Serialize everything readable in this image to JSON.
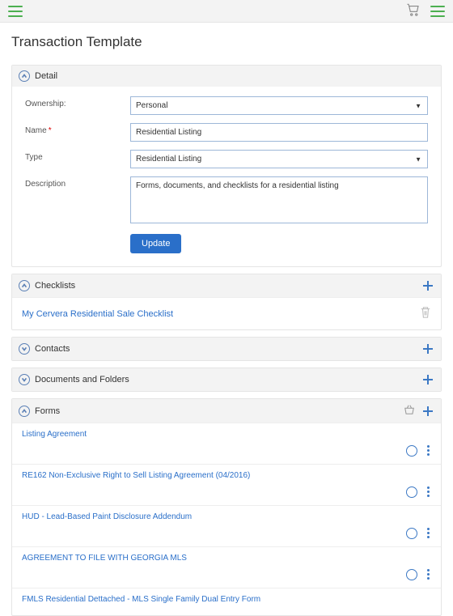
{
  "page": {
    "title": "Transaction Template"
  },
  "detail": {
    "header": "Detail",
    "labels": {
      "ownership": "Ownership:",
      "name": "Name",
      "type": "Type",
      "description": "Description"
    },
    "ownership": "Personal",
    "name": "Residential Listing",
    "type": "Residential Listing",
    "description": "Forms, documents, and checklists for a residential listing",
    "update_btn": "Update"
  },
  "checklists": {
    "header": "Checklists",
    "items": [
      {
        "label": "My Cervera Residential Sale Checklist"
      }
    ]
  },
  "contacts": {
    "header": "Contacts"
  },
  "documents": {
    "header": "Documents and Folders"
  },
  "forms": {
    "header": "Forms",
    "items": [
      {
        "label": "Listing Agreement"
      },
      {
        "label": "RE162 Non-Exclusive Right to Sell Listing Agreement (04/2016)"
      },
      {
        "label": "HUD - Lead-Based Paint Disclosure Addendum"
      },
      {
        "label": "AGREEMENT TO FILE WITH GEORGIA MLS"
      },
      {
        "label": "FMLS Residential Dettached - MLS Single Family Dual Entry Form"
      }
    ]
  }
}
